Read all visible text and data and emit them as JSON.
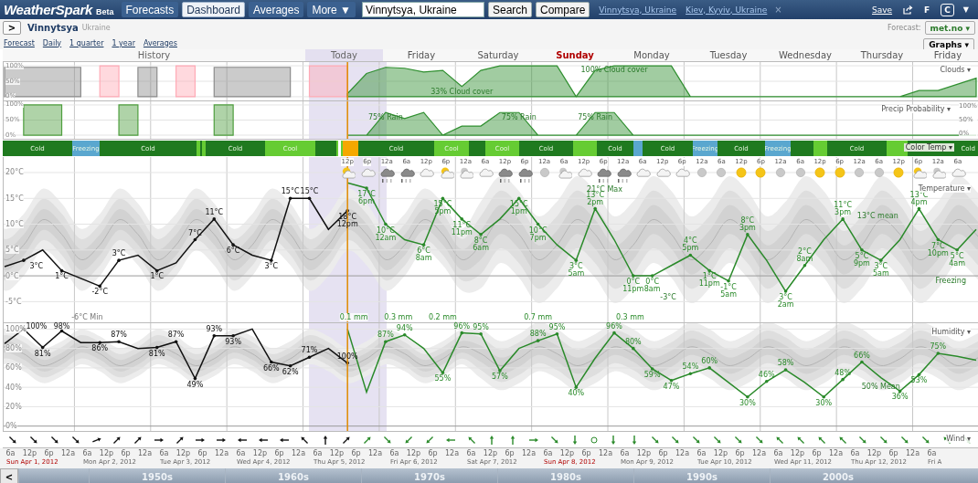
{
  "header": {
    "logo": "WeatherSpark",
    "badge": "Beta",
    "nav": [
      {
        "label": "Forecasts",
        "selected": false
      },
      {
        "label": "Dashboard",
        "selected": true
      },
      {
        "label": "Averages",
        "selected": false
      },
      {
        "label": "More ▼",
        "selected": false
      }
    ],
    "search": {
      "value": "Vinnytsya, Ukraine"
    },
    "buttons": [
      "Search",
      "Compare"
    ],
    "recent": [
      "Vinnytsya, Ukraine",
      "Kiev, Kyyiv, Ukraine"
    ],
    "close": "×",
    "save": "Save",
    "units": [
      {
        "label": "F",
        "selected": false
      },
      {
        "label": "C",
        "selected": true
      }
    ],
    "menu": "▼"
  },
  "location": {
    "toggle": ">",
    "name": "Vinnytsya",
    "country": "Ukraine",
    "forecast_label": "Forecast:",
    "source": "met.no ▾"
  },
  "views": [
    "Forecast",
    "Daily",
    "1 quarter",
    "1 year",
    "Averages"
  ],
  "graphs": "Graphs ▾",
  "days": [
    {
      "label": "History",
      "kind": "history"
    },
    {
      "label": "Today",
      "kind": "today"
    },
    {
      "label": "Friday",
      "kind": "day"
    },
    {
      "label": "Saturday",
      "kind": "day"
    },
    {
      "label": "Sunday",
      "kind": "weekend"
    },
    {
      "label": "Monday",
      "kind": "day"
    },
    {
      "label": "Tuesday",
      "kind": "day"
    },
    {
      "label": "Wednesday",
      "kind": "day"
    },
    {
      "label": "Thursday",
      "kind": "day"
    },
    {
      "label": "Friday",
      "kind": "day"
    }
  ],
  "clouds": {
    "menu": "Clouds ▾",
    "labels": [
      {
        "value": "33% Cloud cover"
      },
      {
        "value": "100% Cloud cover"
      }
    ],
    "chart_data": {
      "type": "area",
      "grid": true,
      "ylim": [
        -12,
        112
      ],
      "yticks": [
        {
          "value": 100,
          "label": "100%"
        },
        {
          "value": 50,
          "label": "50%"
        },
        {
          "value": 0,
          "label": "0%"
        }
      ],
      "categories": [
        null,
        null,
        null,
        null,
        null,
        null,
        null,
        null,
        null,
        null,
        null,
        null,
        null,
        null,
        null,
        null,
        null,
        null,
        null,
        null,
        null,
        null,
        null,
        null,
        null,
        null,
        null,
        null,
        null,
        null,
        null,
        null,
        null,
        null,
        null,
        null,
        null,
        null,
        null,
        null,
        null,
        null,
        null,
        null,
        null,
        null,
        null,
        null,
        null,
        null,
        null,
        null
      ],
      "series": [
        {
          "color": "#8c8c8c",
          "values": [
            95,
            95,
            95,
            95,
            95,
            null,
            null,
            95,
            95,
            null,
            null,
            95,
            95,
            95,
            95,
            95,
            null,
            null,
            null,
            null,
            null,
            null,
            null,
            null,
            null,
            null,
            null,
            null,
            null,
            null,
            null,
            null,
            null,
            null,
            null,
            null,
            null,
            null,
            null,
            null,
            null,
            null,
            null,
            null,
            null,
            null,
            null,
            null,
            null,
            null,
            null,
            null
          ]
        },
        {
          "color": "#ffaab6",
          "values": [
            null,
            null,
            null,
            null,
            null,
            100,
            100,
            null,
            null,
            100,
            100,
            null,
            null,
            null,
            null,
            null,
            100,
            100,
            100,
            null,
            null,
            null,
            null,
            null,
            null,
            null,
            null,
            null,
            null,
            null,
            null,
            null,
            null,
            null,
            null,
            null,
            null,
            null,
            null,
            null,
            null,
            null,
            null,
            null,
            null,
            null,
            null,
            null,
            null,
            null,
            null,
            null
          ]
        },
        {
          "color": "#2f8f2f",
          "values": [
            null,
            null,
            null,
            null,
            null,
            null,
            null,
            null,
            null,
            null,
            null,
            null,
            null,
            null,
            null,
            null,
            null,
            null,
            10,
            75,
            95,
            92,
            80,
            85,
            33,
            85,
            100,
            100,
            100,
            100,
            0,
            85,
            100,
            100,
            100,
            100,
            0,
            0,
            0,
            0,
            0,
            0,
            0,
            0,
            0,
            0,
            0,
            0,
            20,
            20,
            40,
            60
          ]
        }
      ]
    }
  },
  "precip": {
    "menu": "Precip  Probability ▾",
    "right_axis_labels": [
      "100%",
      "50%",
      "0%"
    ],
    "labels": [
      {
        "value": "75% Rain"
      },
      {
        "value": "75% Rain"
      },
      {
        "value": "75% Rain"
      }
    ],
    "chart_data": {
      "type": "area",
      "grid": true,
      "ylim": [
        -12,
        112
      ],
      "yticks": [
        {
          "value": 100,
          "label": "100%"
        },
        {
          "value": 50,
          "label": "50%"
        },
        {
          "value": 0,
          "label": "0%"
        }
      ],
      "categories": [
        null,
        null,
        null,
        null,
        null,
        null,
        null,
        null,
        null,
        null,
        null,
        null,
        null,
        null,
        null,
        null,
        null,
        null,
        null,
        null,
        null,
        null,
        null,
        null,
        null,
        null,
        null,
        null,
        null,
        null,
        null,
        null,
        null,
        null,
        null,
        null,
        null,
        null,
        null,
        null,
        null,
        null,
        null,
        null,
        null,
        null,
        null,
        null,
        null,
        null,
        null,
        null
      ],
      "series": [
        {
          "color": "#4e9e3e",
          "values": [
            null,
            100,
            100,
            100,
            null,
            null,
            100,
            100,
            null,
            null,
            null,
            100,
            100,
            null,
            null,
            null,
            null,
            null,
            null,
            null,
            null,
            null,
            null,
            null,
            null,
            null,
            null,
            null,
            null,
            null,
            null,
            null,
            null,
            null,
            null,
            null,
            null,
            null,
            null,
            null,
            null,
            null,
            null,
            null,
            null,
            null,
            null,
            null,
            null,
            null,
            null,
            null
          ]
        },
        {
          "color": "#2f8f2f",
          "values": [
            null,
            null,
            null,
            null,
            null,
            null,
            null,
            null,
            null,
            null,
            null,
            null,
            null,
            null,
            null,
            null,
            null,
            null,
            0,
            0,
            75,
            55,
            75,
            0,
            30,
            30,
            75,
            75,
            0,
            0,
            0,
            75,
            75,
            0,
            0,
            0,
            0,
            0,
            0,
            0,
            0,
            0,
            0,
            0,
            0,
            0,
            0,
            0,
            0,
            0,
            0,
            0
          ]
        }
      ]
    }
  },
  "color_temp": {
    "menu": "Color Temp ▾",
    "segments": [
      {
        "label": "Cold",
        "color": "#1f7a1f"
      },
      {
        "label": "Freezing",
        "color": "#5aa7cf"
      },
      {
        "label": "Cold",
        "color": "#1f7a1f"
      },
      {
        "color": "#66cc33"
      },
      {
        "color": "#1f7a1f"
      },
      {
        "color": "#66cc33"
      },
      {
        "label": "Cold",
        "color": "#1f7a1f"
      },
      {
        "label": "Cool",
        "color": "#66cc33"
      },
      {
        "color": "#1f7a1f"
      },
      {
        "color": "#66cc33"
      },
      {
        "color": "#ffffff"
      },
      {
        "color": "#66cc33"
      },
      {
        "color": "#f5a800"
      },
      {
        "label": "Cold",
        "color": "#1f7a1f"
      },
      {
        "label": "Cool",
        "color": "#66cc33"
      },
      {
        "color": "#1f7a1f"
      },
      {
        "label": "Cool",
        "color": "#66cc33"
      },
      {
        "label": "Cold",
        "color": "#1f7a1f"
      },
      {
        "color": "#66cc33"
      },
      {
        "label": "Cold",
        "color": "#1f7a1f"
      },
      {
        "color": "#5aa7cf"
      },
      {
        "label": "Cold",
        "color": "#1f7a1f"
      },
      {
        "label": "Freezing",
        "color": "#5aa7cf"
      },
      {
        "label": "Cold",
        "color": "#1f7a1f"
      },
      {
        "label": "Freezing",
        "color": "#5aa7cf"
      },
      {
        "color": "#1f7a1f"
      },
      {
        "color": "#66cc33"
      },
      {
        "label": "Cold",
        "color": "#1f7a1f"
      },
      {
        "color": "#66cc33"
      },
      {
        "label": "Cold",
        "color": "#1f7a1f"
      }
    ]
  },
  "icons": [
    {
      "time": "12p",
      "kind": "partly-sunny",
      "rain": false
    },
    {
      "time": "6p",
      "kind": "cloud",
      "rain": false
    },
    {
      "time": "12a",
      "kind": "overcast",
      "rain": true
    },
    {
      "time": "6a",
      "kind": "overcast",
      "rain": true
    },
    {
      "time": "12p",
      "kind": "cloud",
      "rain": false
    },
    {
      "time": "6p",
      "kind": "partly-sunny",
      "rain": false
    },
    {
      "time": "12a",
      "kind": "partly-night",
      "rain": false
    },
    {
      "time": "6a",
      "kind": "cloud",
      "rain": false
    },
    {
      "time": "12p",
      "kind": "overcast",
      "rain": true
    },
    {
      "time": "6p",
      "kind": "overcast",
      "rain": true
    },
    {
      "time": "12a",
      "kind": "moon",
      "rain": false
    },
    {
      "time": "6a",
      "kind": "partly-night",
      "rain": false
    },
    {
      "time": "12p",
      "kind": "cloud",
      "rain": false
    },
    {
      "time": "6p",
      "kind": "overcast",
      "rain": true
    },
    {
      "time": "12a",
      "kind": "overcast",
      "rain": true
    },
    {
      "time": "6a",
      "kind": "cloud",
      "rain": false
    },
    {
      "time": "12p",
      "kind": "cloud",
      "rain": false
    },
    {
      "time": "6p",
      "kind": "cloud",
      "rain": false
    },
    {
      "time": "12a",
      "kind": "moon",
      "rain": false
    },
    {
      "time": "6a",
      "kind": "moon",
      "rain": false
    },
    {
      "time": "12p",
      "kind": "sun",
      "rain": false
    },
    {
      "time": "6p",
      "kind": "sun",
      "rain": false
    },
    {
      "time": "12a",
      "kind": "moon",
      "rain": false
    },
    {
      "time": "6a",
      "kind": "moon",
      "rain": false
    },
    {
      "time": "12p",
      "kind": "sun",
      "rain": false
    },
    {
      "time": "6p",
      "kind": "sun",
      "rain": false
    },
    {
      "time": "12a",
      "kind": "moon",
      "rain": false
    },
    {
      "time": "6a",
      "kind": "moon",
      "rain": false
    },
    {
      "time": "12p",
      "kind": "sun",
      "rain": false
    },
    {
      "time": "6p",
      "kind": "partly-sunny",
      "rain": false
    },
    {
      "time": "12a",
      "kind": "partly-night",
      "rain": false
    },
    {
      "time": "6a",
      "kind": "cloud",
      "rain": false
    }
  ],
  "temperature": {
    "menu": "Temperature ▾",
    "notes": [
      "-6°C Min",
      "21°C Max",
      "-3°C",
      "13°C mean",
      "Freezing"
    ],
    "rain_totals": [
      "0.1 mm",
      "0.3 mm",
      "0.2 mm",
      "0.7 mm",
      "0.3 mm"
    ],
    "labels": [
      {
        "value": "3°C"
      },
      {
        "value": "1°C"
      },
      {
        "value": "-2°C"
      },
      {
        "value": "3°C"
      },
      {
        "value": "1°C"
      },
      {
        "value": "7°C"
      },
      {
        "value": "11°C"
      },
      {
        "value": "6°C"
      },
      {
        "value": "3°C"
      },
      {
        "value": "15°C"
      },
      {
        "value": "15°C"
      },
      {
        "value": "18°C",
        "time": "12pm"
      },
      {
        "value": "17°C",
        "time": "6pm"
      },
      {
        "value": "10°C",
        "time": "12am"
      },
      {
        "value": "6°C",
        "time": "8am"
      },
      {
        "value": "15°C",
        "time": "5pm"
      },
      {
        "value": "11°C",
        "time": "11pm"
      },
      {
        "value": "8°C",
        "time": "6am"
      },
      {
        "value": "15°C",
        "time": "1pm"
      },
      {
        "value": "10°C",
        "time": "7pm"
      },
      {
        "value": "3°C",
        "time": "5am"
      },
      {
        "value": "13°C",
        "time": "2pm"
      },
      {
        "value": "0°C",
        "time": "11pm"
      },
      {
        "value": "0°C",
        "time": "8am"
      },
      {
        "value": "4°C",
        "time": "5pm"
      },
      {
        "value": "1°C",
        "time": "11pm"
      },
      {
        "value": "-1°C",
        "time": "5am"
      },
      {
        "value": "8°C",
        "time": "3pm"
      },
      {
        "value": "3°C",
        "time": "2am"
      },
      {
        "value": "2°C",
        "time": "8am"
      },
      {
        "value": "11°C",
        "time": "3pm"
      },
      {
        "value": "5°C",
        "time": "9pm"
      },
      {
        "value": "3°C",
        "time": "5am"
      },
      {
        "value": "13°C",
        "time": "4pm"
      },
      {
        "value": "7°C",
        "time": "10pm"
      },
      {
        "value": "5°C",
        "time": "4am"
      }
    ],
    "chart_data": {
      "type": "line",
      "grid": true,
      "ylim": [
        -9,
        23
      ],
      "yticks": [
        {
          "value": 20,
          "label": "20°C"
        },
        {
          "value": 15,
          "label": "15°C"
        },
        {
          "value": 10,
          "label": "10°C"
        },
        {
          "value": 5,
          "label": "5°C"
        },
        {
          "value": 0,
          "label": "0°C"
        },
        {
          "value": -5,
          "label": "-5°C"
        }
      ],
      "categories": [
        null,
        null,
        null,
        null,
        null,
        null,
        null,
        null,
        null,
        null,
        null,
        null,
        null,
        null,
        null,
        null,
        null,
        null,
        null,
        null,
        null,
        null,
        null,
        null,
        null,
        null,
        null,
        null,
        null,
        null,
        null,
        null,
        null,
        null,
        null,
        null,
        null,
        null,
        null,
        null,
        null,
        null,
        null,
        null,
        null,
        null,
        null,
        null,
        null,
        null,
        null,
        null
      ],
      "series": [
        {
          "color": "#111111",
          "values": [
            1.8,
            3,
            5,
            1,
            -0.5,
            -2,
            3,
            4,
            1,
            2.5,
            7,
            11,
            6,
            4,
            3,
            15,
            15,
            9,
            12.6,
            null,
            null,
            null,
            null,
            null,
            null,
            null,
            null,
            null,
            null,
            null,
            null,
            null,
            null,
            null,
            null,
            null,
            null,
            null,
            null,
            null,
            null,
            null,
            null,
            null,
            null,
            null,
            null,
            null,
            null,
            null,
            null,
            null
          ]
        },
        {
          "color": "#2a8a2a",
          "values": [
            null,
            null,
            null,
            null,
            null,
            null,
            null,
            null,
            null,
            null,
            null,
            null,
            null,
            null,
            null,
            null,
            null,
            null,
            18,
            17,
            10,
            7,
            6,
            15,
            11,
            8,
            11,
            15,
            10,
            6,
            3,
            13,
            7,
            0,
            0,
            2,
            4,
            1,
            -1,
            8,
            3,
            -3,
            2,
            7,
            11,
            5,
            3,
            7,
            13,
            7,
            5,
            9
          ]
        }
      ]
    }
  },
  "humidity": {
    "menu": "Humidity ▾",
    "notes": [
      "50% Mean"
    ],
    "labels": [
      {
        "value": "100%"
      },
      {
        "value": "81%"
      },
      {
        "value": "98%"
      },
      {
        "value": "86%"
      },
      {
        "value": "87%"
      },
      {
        "value": "81%"
      },
      {
        "value": "87%"
      },
      {
        "value": "49%"
      },
      {
        "value": "93%"
      },
      {
        "value": "93%"
      },
      {
        "value": "66%"
      },
      {
        "value": "62%"
      },
      {
        "value": "71%"
      },
      {
        "value": "100%"
      },
      {
        "value": "87%"
      },
      {
        "value": "94%"
      },
      {
        "value": "55%"
      },
      {
        "value": "96%"
      },
      {
        "value": "95%"
      },
      {
        "value": "57%"
      },
      {
        "value": "88%"
      },
      {
        "value": "95%"
      },
      {
        "value": "40%"
      },
      {
        "value": "96%"
      },
      {
        "value": "80%"
      },
      {
        "value": "59%"
      },
      {
        "value": "47%"
      },
      {
        "value": "54%"
      },
      {
        "value": "60%"
      },
      {
        "value": "30%"
      },
      {
        "value": "46%"
      },
      {
        "value": "58%"
      },
      {
        "value": "30%"
      },
      {
        "value": "48%"
      },
      {
        "value": "66%"
      },
      {
        "value": "36%"
      },
      {
        "value": "53%"
      },
      {
        "value": "75%"
      }
    ],
    "chart_data": {
      "type": "line",
      "grid": true,
      "ylim": [
        -5,
        106
      ],
      "yticks": [
        {
          "value": 100,
          "label": "100%"
        },
        {
          "value": 80,
          "label": "80%"
        },
        {
          "value": 60,
          "label": "60%"
        },
        {
          "value": 40,
          "label": "40%"
        },
        {
          "value": 20,
          "label": "20%"
        },
        {
          "value": 0,
          "label": "0%"
        }
      ],
      "categories": [
        null,
        null,
        null,
        null,
        null,
        null,
        null,
        null,
        null,
        null,
        null,
        null,
        null,
        null,
        null,
        null,
        null,
        null,
        null,
        null,
        null,
        null,
        null,
        null,
        null,
        null,
        null,
        null,
        null,
        null,
        null,
        null,
        null,
        null,
        null,
        null,
        null,
        null,
        null,
        null,
        null,
        null,
        null,
        null,
        null,
        null,
        null,
        null,
        null,
        null,
        null,
        null
      ],
      "series": [
        {
          "color": "#111111",
          "values": [
            85,
            100,
            81,
            98,
            86,
            86,
            87,
            80,
            81,
            87,
            49,
            93,
            93,
            100,
            66,
            62,
            71,
            80,
            65,
            null,
            null,
            null,
            null,
            null,
            null,
            null,
            null,
            null,
            null,
            null,
            null,
            null,
            null,
            null,
            null,
            null,
            null,
            null,
            null,
            null,
            null,
            null,
            null,
            null,
            null,
            null,
            null,
            null,
            null,
            null,
            null,
            null
          ]
        },
        {
          "color": "#2a8a2a",
          "values": [
            null,
            null,
            null,
            null,
            null,
            null,
            null,
            null,
            null,
            null,
            null,
            null,
            null,
            null,
            null,
            null,
            null,
            null,
            100,
            35,
            87,
            94,
            80,
            55,
            96,
            95,
            57,
            80,
            88,
            95,
            40,
            70,
            96,
            80,
            59,
            47,
            54,
            60,
            45,
            30,
            46,
            58,
            45,
            30,
            48,
            66,
            50,
            36,
            53,
            75,
            72,
            68
          ]
        }
      ]
    }
  },
  "wind": {
    "menu": "Wind ▾",
    "arrows": [
      {
        "kind": "se",
        "forecast": false
      },
      {
        "kind": "se",
        "forecast": false
      },
      {
        "kind": "se",
        "forecast": false
      },
      {
        "kind": "se",
        "forecast": false
      },
      {
        "kind": "ene",
        "forecast": false
      },
      {
        "kind": "ne",
        "forecast": false
      },
      {
        "kind": "ne",
        "forecast": false
      },
      {
        "kind": "e",
        "forecast": false
      },
      {
        "kind": "ne",
        "forecast": false
      },
      {
        "kind": "e",
        "forecast": false
      },
      {
        "kind": "e",
        "forecast": false
      },
      {
        "kind": "w",
        "forecast": false
      },
      {
        "kind": "w",
        "forecast": false
      },
      {
        "kind": "w",
        "forecast": false
      },
      {
        "kind": "nw",
        "forecast": false
      },
      {
        "kind": "n",
        "forecast": false
      },
      {
        "kind": "ne",
        "forecast": false
      },
      {
        "kind": "ne",
        "forecast": true
      },
      {
        "kind": "se",
        "forecast": true
      },
      {
        "kind": "sw",
        "forecast": true
      },
      {
        "kind": "sw",
        "forecast": true
      },
      {
        "kind": "w",
        "forecast": true
      },
      {
        "kind": "nw",
        "forecast": true
      },
      {
        "kind": "n",
        "forecast": true
      },
      {
        "kind": "n",
        "forecast": true
      },
      {
        "kind": "e",
        "forecast": true
      },
      {
        "kind": "se",
        "forecast": true
      },
      {
        "kind": "s",
        "forecast": true
      },
      {
        "kind": "calm",
        "forecast": true
      },
      {
        "kind": "s",
        "forecast": true
      },
      {
        "kind": "s",
        "forecast": true
      },
      {
        "kind": "se",
        "forecast": true
      },
      {
        "kind": "se",
        "forecast": true
      },
      {
        "kind": "se",
        "forecast": true
      },
      {
        "kind": "se",
        "forecast": true
      },
      {
        "kind": "se",
        "forecast": true
      },
      {
        "kind": "se",
        "forecast": true
      },
      {
        "kind": "nw",
        "forecast": true
      },
      {
        "kind": "nw",
        "forecast": true
      },
      {
        "kind": "nw",
        "forecast": true
      },
      {
        "kind": "nw",
        "forecast": true
      },
      {
        "kind": "se",
        "forecast": true
      },
      {
        "kind": "se",
        "forecast": true
      },
      {
        "kind": "se",
        "forecast": true
      },
      {
        "kind": "se",
        "forecast": true
      },
      {
        "kind": "nw",
        "forecast": true
      },
      {
        "kind": "se",
        "forecast": true
      }
    ]
  },
  "timeline": [
    {
      "label": "Sun Apr 1, 2012",
      "weekend": true,
      "hours": [
        "6a",
        "12p",
        "6p",
        "12a"
      ]
    },
    {
      "label": "Mon Apr 2, 2012",
      "weekend": false,
      "hours": [
        "6a",
        "12p",
        "6p",
        "12a"
      ]
    },
    {
      "label": "Tue Apr 3, 2012",
      "weekend": false,
      "hours": [
        "6a",
        "12p",
        "6p",
        "12a"
      ]
    },
    {
      "label": "Wed Apr 4, 2012",
      "weekend": false,
      "hours": [
        "6a",
        "12p",
        "6p",
        "12a"
      ]
    },
    {
      "label": "Thu Apr 5, 2012",
      "weekend": false,
      "hours": [
        "6a",
        "12p",
        "6p",
        "12a"
      ]
    },
    {
      "label": "Fri Apr 6, 2012",
      "weekend": false,
      "hours": [
        "6a",
        "12p",
        "6p",
        "12a"
      ]
    },
    {
      "label": "Sat Apr 7, 2012",
      "weekend": false,
      "hours": [
        "6a",
        "12p",
        "6p",
        "12a"
      ]
    },
    {
      "label": "Sun Apr 8, 2012",
      "weekend": true,
      "hours": [
        "6a",
        "12p",
        "6p",
        "12a"
      ]
    },
    {
      "label": "Mon Apr 9, 2012",
      "weekend": false,
      "hours": [
        "6a",
        "12p",
        "6p",
        "12a"
      ]
    },
    {
      "label": "Tue Apr 10, 2012",
      "weekend": false,
      "hours": [
        "6a",
        "12p",
        "6p",
        "12a"
      ]
    },
    {
      "label": "Wed Apr 11, 2012",
      "weekend": false,
      "hours": [
        "6a",
        "12p",
        "6p",
        "12a"
      ]
    },
    {
      "label": "Thu Apr 12, 2012",
      "weekend": false,
      "hours": [
        "6a",
        "12p",
        "6p",
        "12a"
      ]
    },
    {
      "label": "Fri A",
      "weekend": false,
      "hours": [
        "6a"
      ]
    }
  ],
  "decades": {
    "back": "<",
    "items": [
      "1950s",
      "1960s",
      "1970s",
      "1980s",
      "1990s",
      "2000s"
    ]
  }
}
